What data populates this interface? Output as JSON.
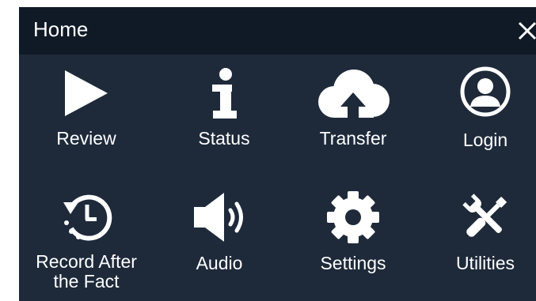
{
  "header": {
    "title": "Home"
  },
  "tiles": [
    {
      "label": "Review",
      "icon": "play-icon"
    },
    {
      "label": "Status",
      "icon": "info-icon"
    },
    {
      "label": "Transfer",
      "icon": "cloud-upload-icon"
    },
    {
      "label": "Login",
      "icon": "user-circle-icon"
    },
    {
      "label_line1": "Record After",
      "label_line2": "the Fact",
      "icon": "history-clock-icon"
    },
    {
      "label": "Audio",
      "icon": "speaker-icon"
    },
    {
      "label": "Settings",
      "icon": "gear-icon"
    },
    {
      "label": "Utilities",
      "icon": "wrench-screwdriver-icon"
    }
  ],
  "colors": {
    "background": "#1e2a3a",
    "header": "#101a26",
    "foreground": "#ffffff"
  }
}
